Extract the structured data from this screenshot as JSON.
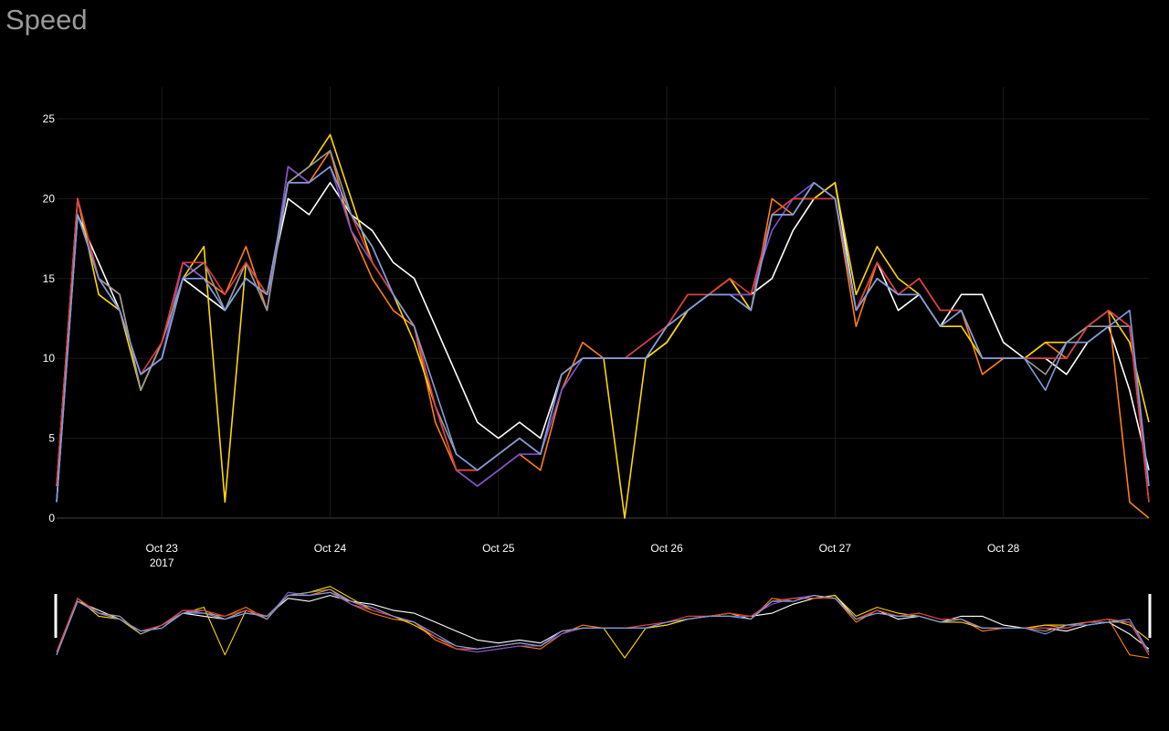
{
  "title": "Speed",
  "chart_data": {
    "type": "line",
    "title": "Speed",
    "xlabel": "",
    "ylabel": "",
    "xlim": [
      "2017-10-22 09:00",
      "2017-10-28 20:45"
    ],
    "ylim": [
      0,
      27
    ],
    "y_ticks": [
      0,
      5,
      10,
      15,
      20,
      25
    ],
    "x_ticks": [
      {
        "date": "2017-10-23",
        "label": "Oct 23",
        "sublabel": "2017"
      },
      {
        "date": "2017-10-24",
        "label": "Oct 24",
        "sublabel": ""
      },
      {
        "date": "2017-10-25",
        "label": "Oct 25",
        "sublabel": ""
      },
      {
        "date": "2017-10-26",
        "label": "Oct 26",
        "sublabel": ""
      },
      {
        "date": "2017-10-27",
        "label": "Oct 27",
        "sublabel": ""
      },
      {
        "date": "2017-10-28",
        "label": "Oct 28",
        "sublabel": ""
      }
    ],
    "grid": true,
    "legend": "none",
    "range_slider": true,
    "x": [
      "2017-10-22 09:00",
      "2017-10-22 12:00",
      "2017-10-22 15:00",
      "2017-10-22 18:00",
      "2017-10-22 21:00",
      "2017-10-23 00:00",
      "2017-10-23 03:00",
      "2017-10-23 06:00",
      "2017-10-23 09:00",
      "2017-10-23 12:00",
      "2017-10-23 15:00",
      "2017-10-23 18:00",
      "2017-10-23 21:00",
      "2017-10-24 00:00",
      "2017-10-24 03:00",
      "2017-10-24 06:00",
      "2017-10-24 09:00",
      "2017-10-24 12:00",
      "2017-10-24 15:00",
      "2017-10-24 18:00",
      "2017-10-24 21:00",
      "2017-10-25 00:00",
      "2017-10-25 03:00",
      "2017-10-25 06:00",
      "2017-10-25 09:00",
      "2017-10-25 12:00",
      "2017-10-25 15:00",
      "2017-10-25 18:00",
      "2017-10-25 21:00",
      "2017-10-26 00:00",
      "2017-10-26 03:00",
      "2017-10-26 06:00",
      "2017-10-26 09:00",
      "2017-10-26 12:00",
      "2017-10-26 15:00",
      "2017-10-26 18:00",
      "2017-10-26 21:00",
      "2017-10-27 00:00",
      "2017-10-27 03:00",
      "2017-10-27 06:00",
      "2017-10-27 09:00",
      "2017-10-27 12:00",
      "2017-10-27 15:00",
      "2017-10-27 18:00",
      "2017-10-27 21:00",
      "2017-10-28 00:00",
      "2017-10-28 03:00",
      "2017-10-28 06:00",
      "2017-10-28 09:00",
      "2017-10-28 12:00",
      "2017-10-28 15:00",
      "2017-10-28 18:00",
      "2017-10-28 20:45"
    ],
    "series": [
      {
        "color": "#ffffff",
        "values": [
          1,
          19,
          16,
          13,
          9,
          10,
          15,
          14,
          13,
          15,
          14,
          20,
          19,
          21,
          19,
          18,
          16,
          15,
          12,
          9,
          6,
          5,
          6,
          5,
          9,
          10,
          10,
          10,
          10,
          11,
          13,
          14,
          14,
          14,
          15,
          18,
          20,
          21,
          13,
          16,
          13,
          14,
          12,
          14,
          14,
          11,
          10,
          10,
          9,
          11,
          12,
          8,
          3
        ]
      },
      {
        "color": "#ff7f0e",
        "values": [
          2,
          20,
          15,
          14,
          8,
          11,
          16,
          15,
          14,
          17,
          13,
          22,
          21,
          23,
          18,
          15,
          13,
          12,
          6,
          3,
          2,
          3,
          4,
          3,
          8,
          11,
          10,
          10,
          10,
          12,
          14,
          14,
          15,
          13,
          20,
          19,
          21,
          20,
          12,
          16,
          14,
          15,
          13,
          13,
          9,
          10,
          10,
          11,
          10,
          12,
          13,
          1,
          0
        ]
      },
      {
        "color": "#ffd700",
        "values": [
          2,
          20,
          14,
          13,
          8,
          11,
          15,
          17,
          1,
          16,
          14,
          21,
          22,
          24,
          20,
          16,
          14,
          11,
          7,
          3,
          3,
          4,
          5,
          4,
          9,
          10,
          10,
          0,
          10,
          11,
          13,
          14,
          15,
          13,
          19,
          20,
          20,
          21,
          14,
          17,
          15,
          14,
          12,
          12,
          10,
          10,
          10,
          11,
          11,
          12,
          13,
          11,
          6
        ]
      },
      {
        "color": "#7b52d8",
        "values": [
          1,
          19,
          15,
          13,
          9,
          10,
          16,
          15,
          13,
          16,
          13,
          22,
          21,
          22,
          18,
          16,
          14,
          12,
          7,
          3,
          2,
          3,
          4,
          4,
          8,
          10,
          10,
          10,
          11,
          12,
          13,
          14,
          14,
          14,
          18,
          20,
          21,
          20,
          13,
          15,
          14,
          15,
          13,
          13,
          10,
          10,
          10,
          10,
          10,
          12,
          13,
          12,
          2
        ]
      },
      {
        "color": "#9a9a9a",
        "values": [
          1,
          20,
          15,
          14,
          8,
          11,
          15,
          16,
          13,
          16,
          13,
          21,
          22,
          23,
          19,
          17,
          14,
          12,
          7,
          4,
          3,
          4,
          5,
          4,
          9,
          10,
          10,
          10,
          10,
          12,
          13,
          14,
          14,
          13,
          19,
          19,
          21,
          20,
          13,
          15,
          14,
          14,
          12,
          13,
          10,
          10,
          10,
          9,
          11,
          12,
          12,
          12,
          1
        ]
      },
      {
        "color": "#e03c3c",
        "values": [
          2,
          20,
          15,
          13,
          9,
          11,
          16,
          16,
          14,
          16,
          14,
          21,
          21,
          22,
          19,
          16,
          14,
          12,
          7,
          3,
          3,
          4,
          5,
          4,
          9,
          10,
          10,
          10,
          11,
          12,
          14,
          14,
          15,
          14,
          19,
          20,
          20,
          20,
          13,
          16,
          14,
          15,
          13,
          13,
          10,
          10,
          10,
          10,
          10,
          12,
          13,
          12,
          1
        ]
      },
      {
        "color": "#7b9ee0",
        "values": [
          1,
          19,
          15,
          13,
          9,
          10,
          15,
          15,
          13,
          15,
          14,
          21,
          21,
          22,
          19,
          17,
          14,
          12,
          8,
          4,
          3,
          4,
          5,
          4,
          9,
          10,
          10,
          10,
          10,
          12,
          13,
          14,
          14,
          13,
          19,
          19,
          21,
          20,
          13,
          15,
          14,
          14,
          12,
          13,
          10,
          10,
          10,
          8,
          11,
          11,
          12,
          13,
          2
        ]
      }
    ]
  }
}
